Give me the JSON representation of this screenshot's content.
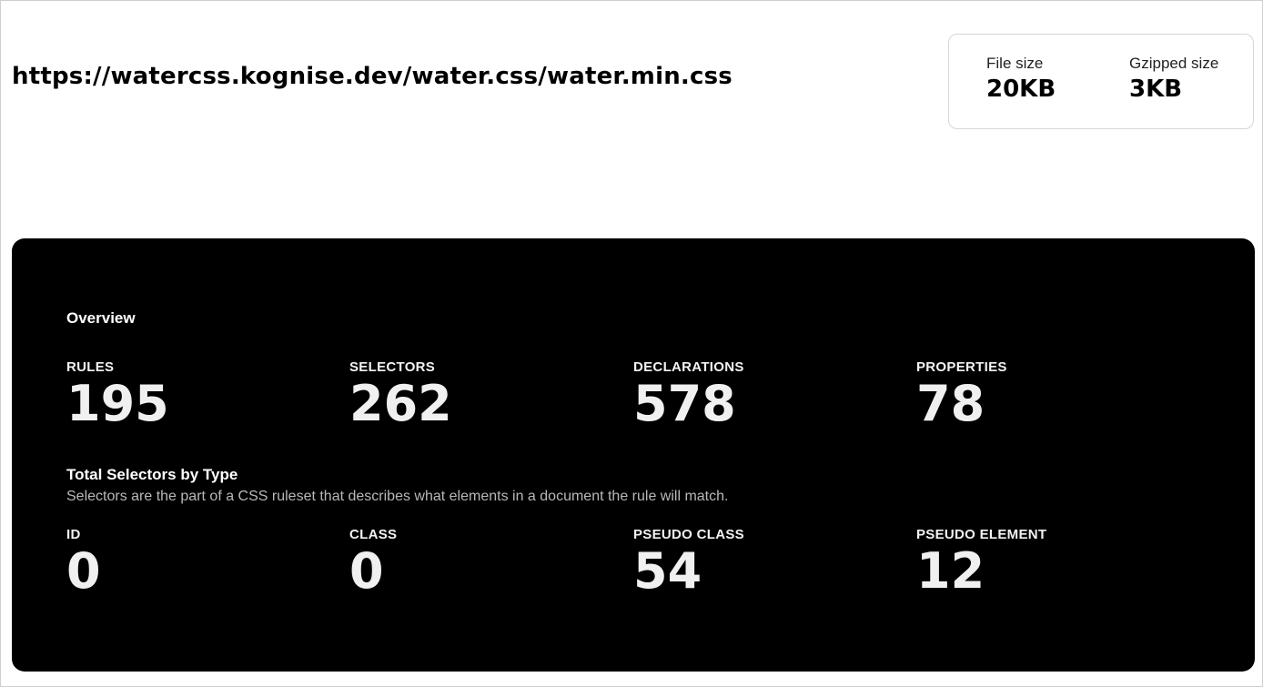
{
  "header": {
    "url": "https://watercss.kognise.dev/water.css/water.min.css"
  },
  "size_card": {
    "file_size_label": "File size",
    "file_size_value": "20KB",
    "gzip_label": "Gzipped size",
    "gzip_value": "3KB"
  },
  "overview": {
    "heading": "Overview",
    "stats": [
      {
        "label": "RULES",
        "value": "195"
      },
      {
        "label": "SELECTORS",
        "value": "262"
      },
      {
        "label": "DECLARATIONS",
        "value": "578"
      },
      {
        "label": "PROPERTIES",
        "value": "78"
      }
    ]
  },
  "selector_types": {
    "heading": "Total Selectors by Type",
    "description": "Selectors are the part of a CSS ruleset that describes what elements in a document the rule will match.",
    "stats": [
      {
        "label": "ID",
        "value": "0"
      },
      {
        "label": "CLASS",
        "value": "0"
      },
      {
        "label": "PSEUDO CLASS",
        "value": "54"
      },
      {
        "label": "PSEUDO ELEMENT",
        "value": "12"
      }
    ]
  },
  "colors": {
    "panel_background": "#000000",
    "page_background": "#ffffff"
  }
}
